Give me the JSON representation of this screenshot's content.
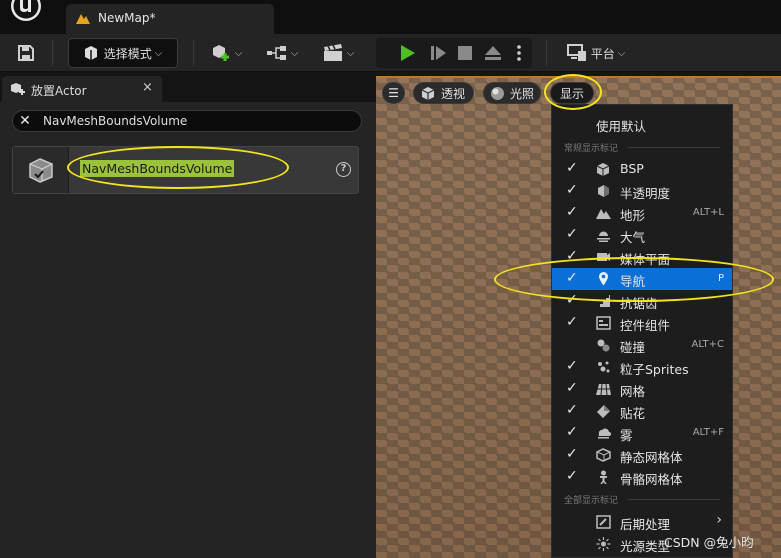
{
  "title_bar": {
    "tab_label": "NewMap*"
  },
  "toolbar": {
    "mode_label": "选择模式",
    "platform_label": "平台"
  },
  "place_actors_panel": {
    "tab_label": "放置Actor",
    "close_glyph": "×",
    "search": {
      "value": "NavMeshBoundsVolume",
      "clear_glyph": "✕"
    },
    "results": [
      {
        "name": "NavMeshBoundsVolume",
        "help_glyph": "?"
      }
    ]
  },
  "viewport": {
    "menu_glyph": "☰",
    "perspective_label": "透视",
    "lit_label": "光照",
    "show_label": "显示"
  },
  "show_menu": {
    "use_defaults_label": "使用默认",
    "common_section_label": "常规显示标记",
    "all_section_label": "全部显示标记",
    "items": [
      {
        "label": "BSP",
        "checked": true,
        "shortcut": "",
        "icon": "cube-icon"
      },
      {
        "label": "半透明度",
        "checked": true,
        "shortcut": "",
        "icon": "translucency-icon"
      },
      {
        "label": "地形",
        "checked": true,
        "shortcut": "ALT+L",
        "icon": "landscape-icon"
      },
      {
        "label": "大气",
        "checked": true,
        "shortcut": "",
        "icon": "atmosphere-icon"
      },
      {
        "label": "媒体平面",
        "checked": true,
        "shortcut": "",
        "icon": "media-plane-icon"
      },
      {
        "label": "导航",
        "checked": true,
        "shortcut": "P",
        "icon": "navigation-pin-icon",
        "highlighted": true
      },
      {
        "label": "抗锯齿",
        "checked": true,
        "shortcut": "",
        "icon": "antialias-icon"
      },
      {
        "label": "控件组件",
        "checked": true,
        "shortcut": "",
        "icon": "widget-icon"
      },
      {
        "label": "碰撞",
        "checked": false,
        "shortcut": "ALT+C",
        "icon": "collision-icon"
      },
      {
        "label": "粒子Sprites",
        "checked": true,
        "shortcut": "",
        "icon": "particles-icon"
      },
      {
        "label": "网格",
        "checked": true,
        "shortcut": "",
        "icon": "grid-icon"
      },
      {
        "label": "贴花",
        "checked": true,
        "shortcut": "",
        "icon": "decal-icon"
      },
      {
        "label": "雾",
        "checked": true,
        "shortcut": "ALT+F",
        "icon": "fog-icon"
      },
      {
        "label": "静态网格体",
        "checked": true,
        "shortcut": "",
        "icon": "static-mesh-icon"
      },
      {
        "label": "骨骼网格体",
        "checked": true,
        "shortcut": "",
        "icon": "skeletal-mesh-icon"
      }
    ],
    "all_items": [
      {
        "label": "后期处理",
        "submenu": true,
        "icon": "post-process-icon"
      },
      {
        "label": "光源类型",
        "submenu": false,
        "icon": "light-type-icon"
      }
    ]
  },
  "watermark": "CSDN @兔小昀",
  "colors": {
    "highlight_blue": "#0a6fd6",
    "annotation_yellow": "#f3e51b",
    "selection_green": "#9ac23b",
    "play_green": "#4fbf26"
  }
}
